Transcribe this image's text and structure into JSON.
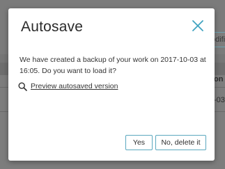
{
  "background": {
    "modify_button_label": "odifi",
    "column_header": "on",
    "cell_value": "-03"
  },
  "dialog": {
    "title": "Autosave",
    "message": "We have created a backup of your work on 2017-10-03 at 16:05. Do you want to load it?",
    "preview_link": "Preview autosaved version",
    "yes_label": "Yes",
    "no_label": "No, delete it"
  },
  "colors": {
    "accent": "#3fa3c0",
    "overlay": "#7d7d7d"
  },
  "icons": [
    "close-icon",
    "search-icon"
  ]
}
